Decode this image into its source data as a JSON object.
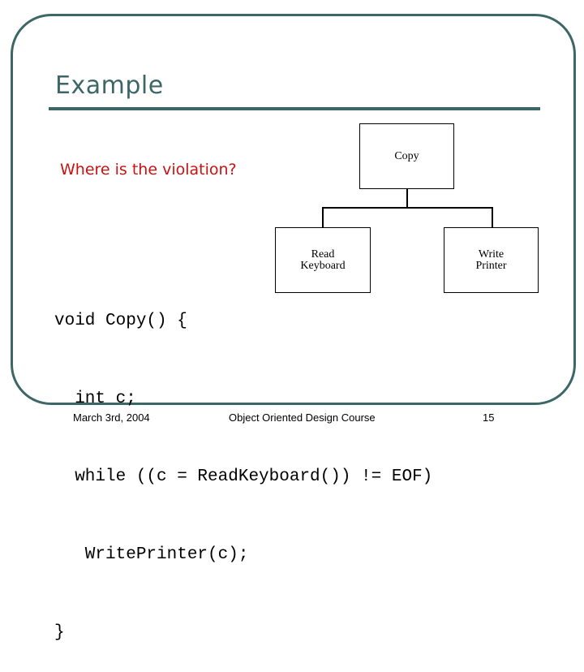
{
  "slide": {
    "title": "Example",
    "question": "Where is the violation?",
    "diagram": {
      "root": {
        "label_lines": [
          "Copy"
        ]
      },
      "children": [
        {
          "label_lines": [
            "Read",
            "Keyboard"
          ]
        },
        {
          "label_lines": [
            "Write",
            "Printer"
          ]
        }
      ]
    },
    "code_lines": [
      "void Copy() {",
      "  int c;",
      "  while ((c = ReadKeyboard()) != EOF)",
      "   WritePrinter(c);",
      "}"
    ],
    "footer": {
      "date": "March 3rd, 2004",
      "course": "Object Oriented Design Course",
      "page": "15"
    },
    "colors": {
      "accent": "#3d6666",
      "question": "#cc1111"
    }
  }
}
